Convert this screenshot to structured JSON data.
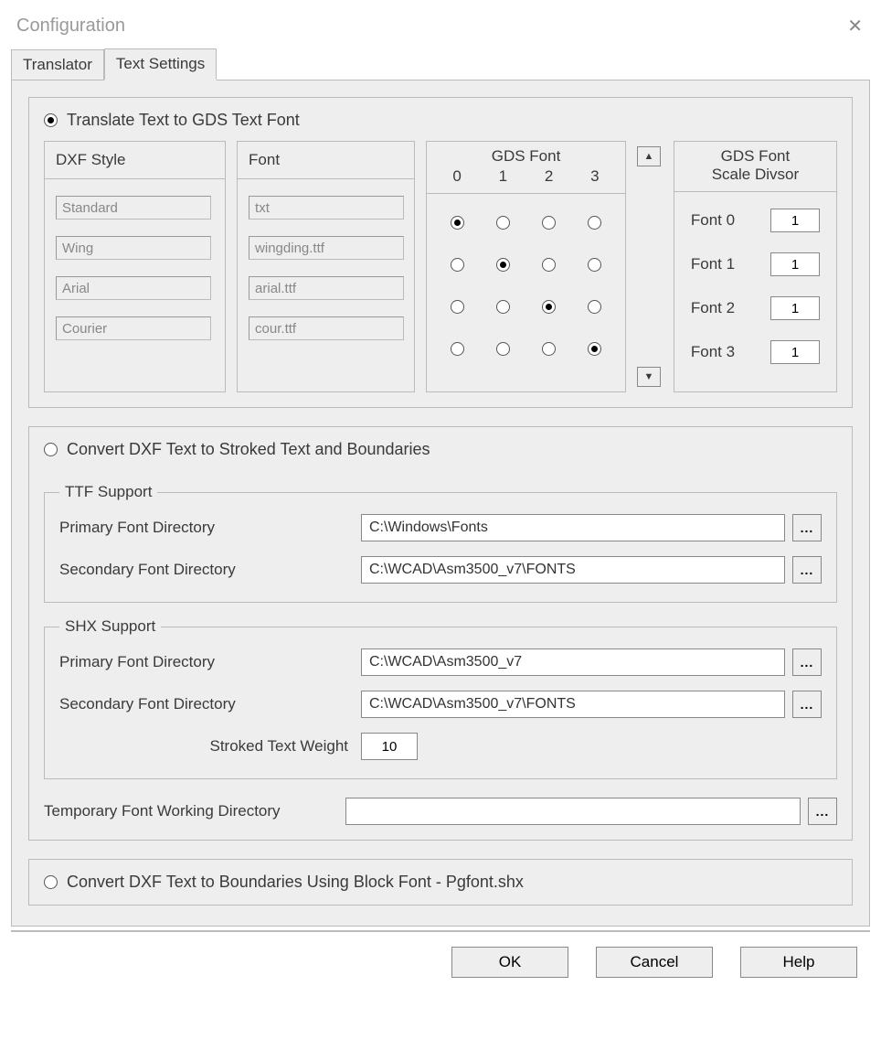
{
  "window_title": "Configuration",
  "tabs": {
    "translator": "Translator",
    "text_settings": "Text Settings"
  },
  "radios": {
    "translate_gds": "Translate Text to GDS Text Font",
    "convert_stroked": "Convert DXF Text to Stroked Text and Boundaries",
    "convert_block": "Convert DXF Text to Boundaries Using Block Font - Pgfont.shx",
    "selected": "translate_gds"
  },
  "headers": {
    "dxf_style": "DXF Style",
    "font": "Font",
    "gds_font": "GDS Font",
    "scale_divsor_a": "GDS Font",
    "scale_divsor_b": "Scale Divsor"
  },
  "gds_cols": [
    "0",
    "1",
    "2",
    "3"
  ],
  "rows": [
    {
      "style": "Standard",
      "font": "txt",
      "sel": 0
    },
    {
      "style": "Wing",
      "font": "wingding.ttf",
      "sel": 1
    },
    {
      "style": "Arial",
      "font": "arial.ttf",
      "sel": 2
    },
    {
      "style": "Courier",
      "font": "cour.ttf",
      "sel": 3
    }
  ],
  "divsor": [
    {
      "label": "Font 0",
      "val": "1"
    },
    {
      "label": "Font 1",
      "val": "1"
    },
    {
      "label": "Font 2",
      "val": "1"
    },
    {
      "label": "Font 3",
      "val": "1"
    }
  ],
  "ttf": {
    "legend": "TTF Support",
    "primary_label": "Primary Font Directory",
    "primary_val": "C:\\Windows\\Fonts",
    "secondary_label": "Secondary Font Directory",
    "secondary_val": "C:\\WCAD\\Asm3500_v7\\FONTS"
  },
  "shx": {
    "legend": "SHX Support",
    "primary_label": "Primary Font Directory",
    "primary_val": "C:\\WCAD\\Asm3500_v7",
    "secondary_label": "Secondary Font Directory",
    "secondary_val": "C:\\WCAD\\Asm3500_v7\\FONTS",
    "weight_label": "Stroked Text Weight",
    "weight_val": "10"
  },
  "temp": {
    "label": "Temporary Font Working Directory",
    "val": ""
  },
  "buttons": {
    "ok": "OK",
    "cancel": "Cancel",
    "help": "Help"
  },
  "browse_label": "..."
}
